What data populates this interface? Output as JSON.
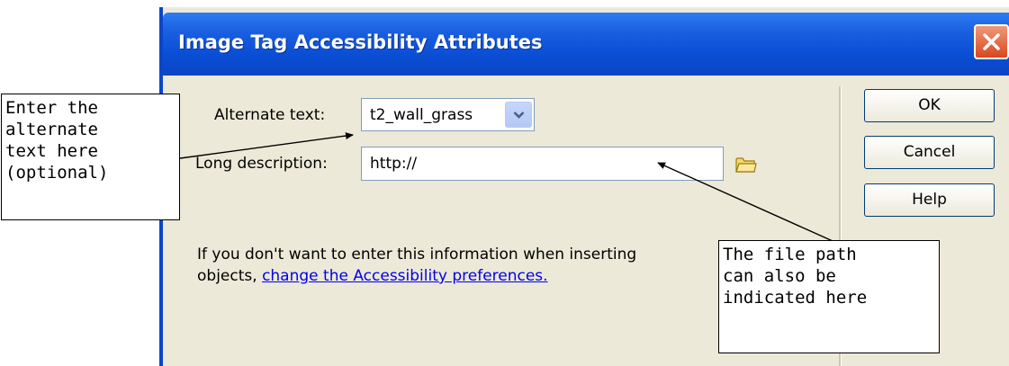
{
  "dialog": {
    "title": "Image Tag Accessibility Attributes",
    "fields": {
      "alt_label": "Alternate text:",
      "alt_value": "t2_wall_grass",
      "long_desc_label": "Long description:",
      "long_desc_value": "http://"
    },
    "buttons": {
      "ok": "OK",
      "cancel": "Cancel",
      "help": "Help"
    },
    "info": {
      "line1": "If you don't want to enter this information when inserting",
      "line2_prefix": "objects, ",
      "link": "change the Accessibility preferences."
    },
    "icons": [
      "close-icon",
      "chevron-down-icon",
      "folder-icon"
    ],
    "colors": {
      "titlebar": "#0a4fd6",
      "body": "#ece9d8",
      "close": "#d9471f"
    }
  },
  "callouts": {
    "left": "Enter the\nalternate\ntext here\n(optional)",
    "right": "The file path\ncan also be\nindicated here"
  }
}
